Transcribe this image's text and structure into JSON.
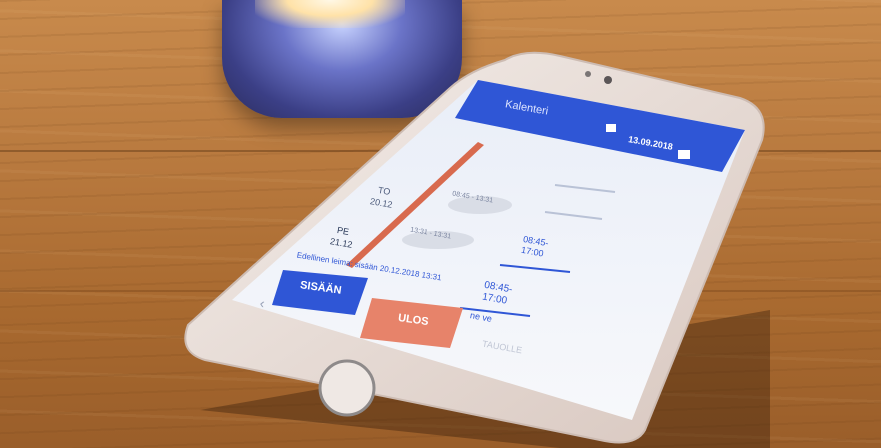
{
  "app": {
    "header_title": "Kalenteri",
    "header_date": "13.09.2018",
    "days": [
      {
        "label": "TO",
        "date": "20.12"
      },
      {
        "label": "PE",
        "date": "21.12"
      }
    ],
    "shift_times": [
      "08:45-\n17:00",
      "08:45-\n17:00"
    ],
    "short_shift_a": "08:45 - 13:31",
    "short_shift_b": "13:31 - 13:31",
    "status_text": "Edellinen leima: sisään 20.12.2018 13:31",
    "sisaan_button_label": "SISÄÄN",
    "ulos_button_label": "ULOS",
    "tauolle_label": "TAUOLLE",
    "more_label": "ne ve"
  },
  "colors": {
    "primary_blue": "#2f56d6",
    "ulos_orange": "#e7836a",
    "timeline_red": "#d86a4e"
  },
  "icons": [
    "calendar-icon",
    "back-chevron-icon",
    "home-icon"
  ]
}
